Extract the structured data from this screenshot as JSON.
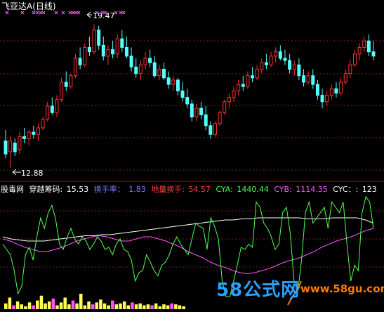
{
  "title": "飞亚达A(日线)",
  "price_high_label": "19.47",
  "price_low_label": "12.88",
  "indicator_bar": {
    "source": "股毒网",
    "name_label": "穿越筹码:",
    "name_value": "15.53",
    "turnover_label": "换手率：",
    "turnover_value": "1.83",
    "ground_turnover_label": "地量换手:",
    "ground_turnover_value": "54.57",
    "cya_label": "CYA:",
    "cya_value": "1440.44",
    "cyb_label": "CYB:",
    "cyb_value": "1114.35",
    "cyc_label": "CYC：:",
    "cyc_value": "123"
  },
  "watermark": {
    "logo": "58公式网",
    "site": "www.58gu.com"
  },
  "colors": {
    "up": "#ff3232",
    "down": "#54ffff",
    "cya": "#54ff54",
    "cyb": "#ff54ff",
    "cyc": "#ffffff",
    "grid": "#802020",
    "marker": "#ff54ff",
    "volume": "#ffff54"
  },
  "chart_data": {
    "type": "candlestick",
    "price_range": [
      12.5,
      20.0
    ],
    "candles": [
      {
        "o": 14.1,
        "h": 14.6,
        "l": 13.3,
        "c": 13.5
      },
      {
        "o": 13.6,
        "h": 14.3,
        "l": 12.88,
        "c": 14.1
      },
      {
        "o": 14.0,
        "h": 14.2,
        "l": 13.4,
        "c": 13.6
      },
      {
        "o": 13.7,
        "h": 14.5,
        "l": 13.5,
        "c": 14.3
      },
      {
        "o": 14.3,
        "h": 14.7,
        "l": 14.0,
        "c": 14.2
      },
      {
        "o": 14.2,
        "h": 14.6,
        "l": 13.9,
        "c": 14.5
      },
      {
        "o": 14.5,
        "h": 14.8,
        "l": 14.2,
        "c": 14.4
      },
      {
        "o": 14.4,
        "h": 14.9,
        "l": 14.1,
        "c": 14.7
      },
      {
        "o": 14.7,
        "h": 15.2,
        "l": 14.6,
        "c": 15.1
      },
      {
        "o": 15.1,
        "h": 15.9,
        "l": 15.0,
        "c": 15.7
      },
      {
        "o": 15.7,
        "h": 16.1,
        "l": 15.3,
        "c": 15.4
      },
      {
        "o": 15.4,
        "h": 16.2,
        "l": 15.2,
        "c": 16.0
      },
      {
        "o": 16.0,
        "h": 17.0,
        "l": 15.9,
        "c": 16.8
      },
      {
        "o": 16.8,
        "h": 17.3,
        "l": 16.4,
        "c": 16.6
      },
      {
        "o": 16.6,
        "h": 17.2,
        "l": 16.5,
        "c": 17.1
      },
      {
        "o": 17.1,
        "h": 18.1,
        "l": 17.0,
        "c": 17.9
      },
      {
        "o": 17.9,
        "h": 18.4,
        "l": 17.4,
        "c": 17.6
      },
      {
        "o": 17.6,
        "h": 18.6,
        "l": 17.5,
        "c": 18.4
      },
      {
        "o": 18.4,
        "h": 18.9,
        "l": 18.0,
        "c": 18.2
      },
      {
        "o": 18.2,
        "h": 19.47,
        "l": 18.1,
        "c": 19.2
      },
      {
        "o": 19.2,
        "h": 19.4,
        "l": 18.3,
        "c": 18.5
      },
      {
        "o": 18.5,
        "h": 18.9,
        "l": 17.8,
        "c": 18.0
      },
      {
        "o": 18.0,
        "h": 18.5,
        "l": 17.6,
        "c": 18.3
      },
      {
        "o": 18.3,
        "h": 18.7,
        "l": 17.9,
        "c": 18.1
      },
      {
        "o": 18.1,
        "h": 19.0,
        "l": 17.9,
        "c": 18.8
      },
      {
        "o": 18.8,
        "h": 19.2,
        "l": 18.2,
        "c": 18.4
      },
      {
        "o": 18.4,
        "h": 18.9,
        "l": 17.9,
        "c": 18.0
      },
      {
        "o": 18.0,
        "h": 18.4,
        "l": 17.3,
        "c": 17.5
      },
      {
        "o": 17.5,
        "h": 17.9,
        "l": 17.0,
        "c": 17.2
      },
      {
        "o": 17.2,
        "h": 17.8,
        "l": 16.9,
        "c": 17.6
      },
      {
        "o": 17.6,
        "h": 18.2,
        "l": 17.4,
        "c": 17.9
      },
      {
        "o": 17.9,
        "h": 18.3,
        "l": 17.5,
        "c": 17.7
      },
      {
        "o": 17.7,
        "h": 18.0,
        "l": 17.0,
        "c": 17.1
      },
      {
        "o": 17.1,
        "h": 17.6,
        "l": 16.9,
        "c": 17.4
      },
      {
        "o": 17.4,
        "h": 17.7,
        "l": 16.9,
        "c": 17.0
      },
      {
        "o": 17.0,
        "h": 17.3,
        "l": 16.5,
        "c": 16.7
      },
      {
        "o": 16.7,
        "h": 17.1,
        "l": 16.4,
        "c": 16.9
      },
      {
        "o": 16.9,
        "h": 17.0,
        "l": 16.2,
        "c": 16.4
      },
      {
        "o": 16.4,
        "h": 16.8,
        "l": 15.9,
        "c": 16.1
      },
      {
        "o": 16.1,
        "h": 16.5,
        "l": 15.6,
        "c": 15.8
      },
      {
        "o": 15.8,
        "h": 16.0,
        "l": 15.0,
        "c": 15.2
      },
      {
        "o": 15.2,
        "h": 15.8,
        "l": 15.0,
        "c": 15.6
      },
      {
        "o": 15.6,
        "h": 15.9,
        "l": 15.1,
        "c": 15.3
      },
      {
        "o": 15.3,
        "h": 15.7,
        "l": 14.6,
        "c": 14.8
      },
      {
        "o": 14.8,
        "h": 15.0,
        "l": 14.2,
        "c": 14.4
      },
      {
        "o": 14.4,
        "h": 15.0,
        "l": 14.3,
        "c": 14.9
      },
      {
        "o": 14.9,
        "h": 15.5,
        "l": 14.8,
        "c": 15.4
      },
      {
        "o": 15.4,
        "h": 16.0,
        "l": 15.3,
        "c": 15.9
      },
      {
        "o": 15.9,
        "h": 16.3,
        "l": 15.6,
        "c": 16.1
      },
      {
        "o": 16.1,
        "h": 16.6,
        "l": 15.9,
        "c": 16.4
      },
      {
        "o": 16.4,
        "h": 16.9,
        "l": 16.2,
        "c": 16.7
      },
      {
        "o": 16.7,
        "h": 17.1,
        "l": 16.4,
        "c": 16.6
      },
      {
        "o": 16.6,
        "h": 17.3,
        "l": 16.5,
        "c": 17.1
      },
      {
        "o": 17.1,
        "h": 17.5,
        "l": 16.8,
        "c": 17.0
      },
      {
        "o": 17.0,
        "h": 17.6,
        "l": 16.9,
        "c": 17.4
      },
      {
        "o": 17.4,
        "h": 17.9,
        "l": 17.2,
        "c": 17.7
      },
      {
        "o": 17.7,
        "h": 18.1,
        "l": 17.4,
        "c": 17.6
      },
      {
        "o": 17.6,
        "h": 18.2,
        "l": 17.5,
        "c": 18.0
      },
      {
        "o": 18.0,
        "h": 18.4,
        "l": 17.7,
        "c": 18.2
      },
      {
        "o": 18.2,
        "h": 18.5,
        "l": 17.8,
        "c": 17.9
      },
      {
        "o": 17.9,
        "h": 18.3,
        "l": 17.6,
        "c": 17.8
      },
      {
        "o": 17.8,
        "h": 18.1,
        "l": 17.2,
        "c": 17.4
      },
      {
        "o": 17.4,
        "h": 17.8,
        "l": 17.1,
        "c": 17.6
      },
      {
        "o": 17.6,
        "h": 17.9,
        "l": 16.9,
        "c": 17.1
      },
      {
        "o": 17.1,
        "h": 17.4,
        "l": 16.6,
        "c": 16.8
      },
      {
        "o": 16.8,
        "h": 17.3,
        "l": 16.7,
        "c": 17.1
      },
      {
        "o": 17.1,
        "h": 17.4,
        "l": 16.5,
        "c": 16.7
      },
      {
        "o": 16.7,
        "h": 16.9,
        "l": 16.0,
        "c": 16.2
      },
      {
        "o": 16.2,
        "h": 16.5,
        "l": 15.6,
        "c": 15.9
      },
      {
        "o": 15.9,
        "h": 16.4,
        "l": 15.7,
        "c": 16.2
      },
      {
        "o": 16.2,
        "h": 16.7,
        "l": 16.0,
        "c": 16.5
      },
      {
        "o": 16.5,
        "h": 16.8,
        "l": 16.1,
        "c": 16.3
      },
      {
        "o": 16.3,
        "h": 17.0,
        "l": 16.2,
        "c": 16.8
      },
      {
        "o": 16.8,
        "h": 17.4,
        "l": 16.7,
        "c": 17.2
      },
      {
        "o": 17.2,
        "h": 17.8,
        "l": 17.0,
        "c": 17.6
      },
      {
        "o": 17.6,
        "h": 18.3,
        "l": 17.5,
        "c": 18.1
      },
      {
        "o": 18.1,
        "h": 18.6,
        "l": 17.8,
        "c": 18.4
      },
      {
        "o": 18.4,
        "h": 18.9,
        "l": 18.2,
        "c": 18.7
      },
      {
        "o": 18.7,
        "h": 19.0,
        "l": 18.0,
        "c": 18.2
      },
      {
        "o": 18.2,
        "h": 18.7,
        "l": 17.8,
        "c": 18.0
      }
    ],
    "marker_columns": [
      10,
      32,
      48,
      53,
      58,
      62,
      80,
      90,
      100,
      104,
      108,
      112,
      138,
      146,
      150,
      165,
      172,
      176
    ],
    "volume": [
      30,
      60,
      20,
      40,
      25,
      15,
      35,
      20,
      45,
      70,
      30,
      40,
      55,
      20,
      35,
      60,
      25,
      45,
      30,
      80,
      20,
      40,
      25,
      35,
      50,
      30,
      20,
      45,
      25,
      30,
      40,
      20,
      35,
      25,
      30,
      20,
      25,
      20,
      30,
      15,
      25,
      20,
      30,
      25,
      20,
      15
    ],
    "cya": [
      0.55,
      0.5,
      0.45,
      0.3,
      0.08,
      0.15,
      0.45,
      0.52,
      0.4,
      0.62,
      0.8,
      0.7,
      0.85,
      0.92,
      0.78,
      0.55,
      0.5,
      0.62,
      0.7,
      0.6,
      0.55,
      0.62,
      0.58,
      0.5,
      0.55,
      0.62,
      0.58,
      0.5,
      0.52,
      0.45,
      0.55,
      0.6,
      0.5,
      0.48,
      0.4,
      0.2,
      0.28,
      0.3,
      0.45,
      0.38,
      0.3,
      0.25,
      0.35,
      0.38,
      0.45,
      0.55,
      0.62,
      0.55,
      0.5,
      0.45,
      0.6,
      0.75,
      0.72,
      0.7,
      0.5,
      0.8,
      0.72,
      0.6,
      0.2,
      0.05,
      0.05,
      0.2,
      0.35,
      0.52,
      0.5,
      0.55,
      0.52,
      0.95,
      0.9,
      0.75,
      0.7,
      0.62,
      0.5,
      0.55,
      0.85,
      0.9,
      0.65,
      0.2,
      0.1,
      0.4,
      0.85,
      0.95,
      0.75,
      0.8,
      0.85,
      0.9,
      0.7,
      0.95,
      0.9,
      0.85,
      0.95,
      0.55,
      0.2,
      0.35,
      0.3,
      0.85,
      1.0,
      0.95,
      0.7
    ],
    "cyb": [
      0.6,
      0.58,
      0.55,
      0.52,
      0.5,
      0.48,
      0.48,
      0.5,
      0.52,
      0.55,
      0.58,
      0.6,
      0.62,
      0.63,
      0.62,
      0.6,
      0.58,
      0.58,
      0.6,
      0.62,
      0.62,
      0.6,
      0.58,
      0.55,
      0.52,
      0.48,
      0.45,
      0.42,
      0.38,
      0.35,
      0.33,
      0.3,
      0.28,
      0.27,
      0.28,
      0.3,
      0.32,
      0.35,
      0.38,
      0.4,
      0.42,
      0.45,
      0.48,
      0.52,
      0.55,
      0.58,
      0.6,
      0.62,
      0.65,
      0.68,
      0.7
    ],
    "cyc": [
      0.62,
      0.6,
      0.59,
      0.58,
      0.58,
      0.58,
      0.59,
      0.6,
      0.61,
      0.62,
      0.63,
      0.63,
      0.64,
      0.64,
      0.65,
      0.66,
      0.67,
      0.68,
      0.69,
      0.7,
      0.71,
      0.72,
      0.73,
      0.74,
      0.75,
      0.76,
      0.77,
      0.78,
      0.78,
      0.79,
      0.79,
      0.8,
      0.8,
      0.8,
      0.8,
      0.8,
      0.8,
      0.79,
      0.79,
      0.79,
      0.8,
      0.8,
      0.8,
      0.8,
      0.78,
      0.75
    ]
  }
}
